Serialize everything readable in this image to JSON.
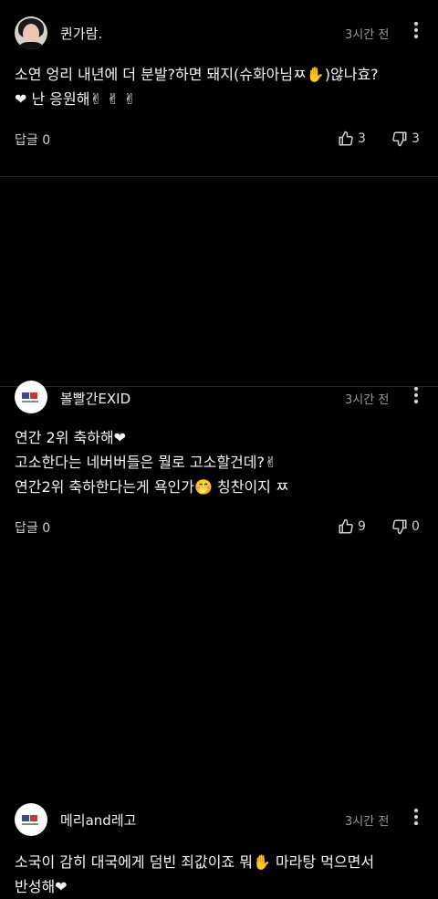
{
  "comments": [
    {
      "author": "퀸가람.",
      "time": "3시간 전",
      "lines": [
        "소연 엉리 내년에 더 분발?하면 돼지(슈화아님ㅉ✋)않나효?",
        "❤  난 응원해✌ ✌ ✌"
      ],
      "reply_label": "답글 0",
      "likes": "3",
      "dislikes": "3"
    },
    {
      "author": "볼빨간EXID",
      "time": "3시간 전",
      "lines": [
        "연간 2위 축하해❤",
        "고소한다는 네버버들은 뭘로 고소할건데?✌",
        "연간2위 축하한다는게 욕인가🤭 칭찬이지 ㅉ"
      ],
      "reply_label": "답글 0",
      "likes": "9",
      "dislikes": "0"
    },
    {
      "author": "메리and레고",
      "time": "3시간 전",
      "lines": [
        "소국이 감히 대국에게 덤빈 죄값이죠 뭐✋ 마라탕 먹으면서",
        "반성해❤"
      ]
    }
  ]
}
